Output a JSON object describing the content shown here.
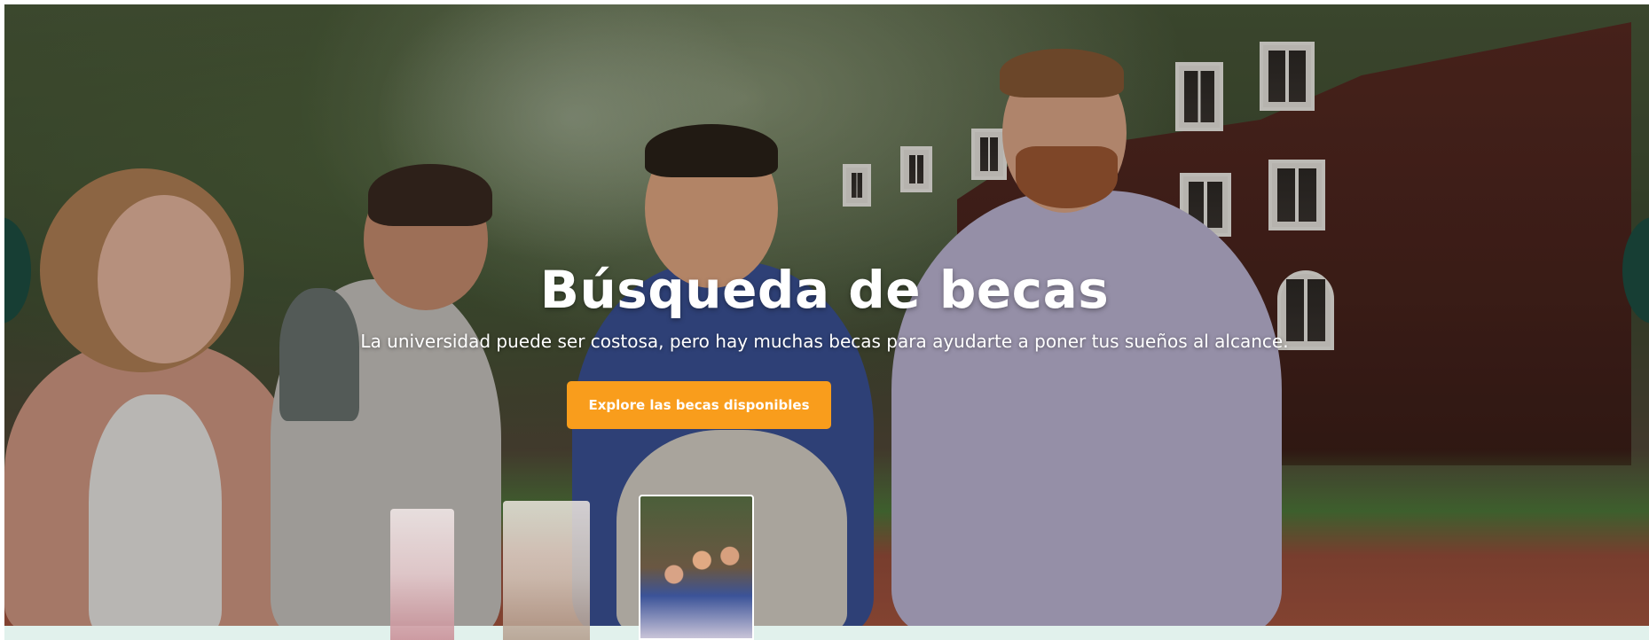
{
  "hero": {
    "title": "Búsqueda de becas",
    "subtitle": "La universidad puede ser costosa, pero hay muchas becas para ayudarte a poner tus sueños al alcance.",
    "cta_label": "Explore las becas disponibles",
    "background_image": "group-of-students-walking-on-campus"
  },
  "carousel": {
    "thumbnails": [
      "thumbnail-1",
      "thumbnail-2",
      "thumbnail-3"
    ],
    "active_index": 3
  },
  "colors": {
    "cta": "#f99d1c",
    "title_text": "#ffffff",
    "carousel_nav": "#173e34",
    "thumb_bar": "#e1f1ec"
  }
}
